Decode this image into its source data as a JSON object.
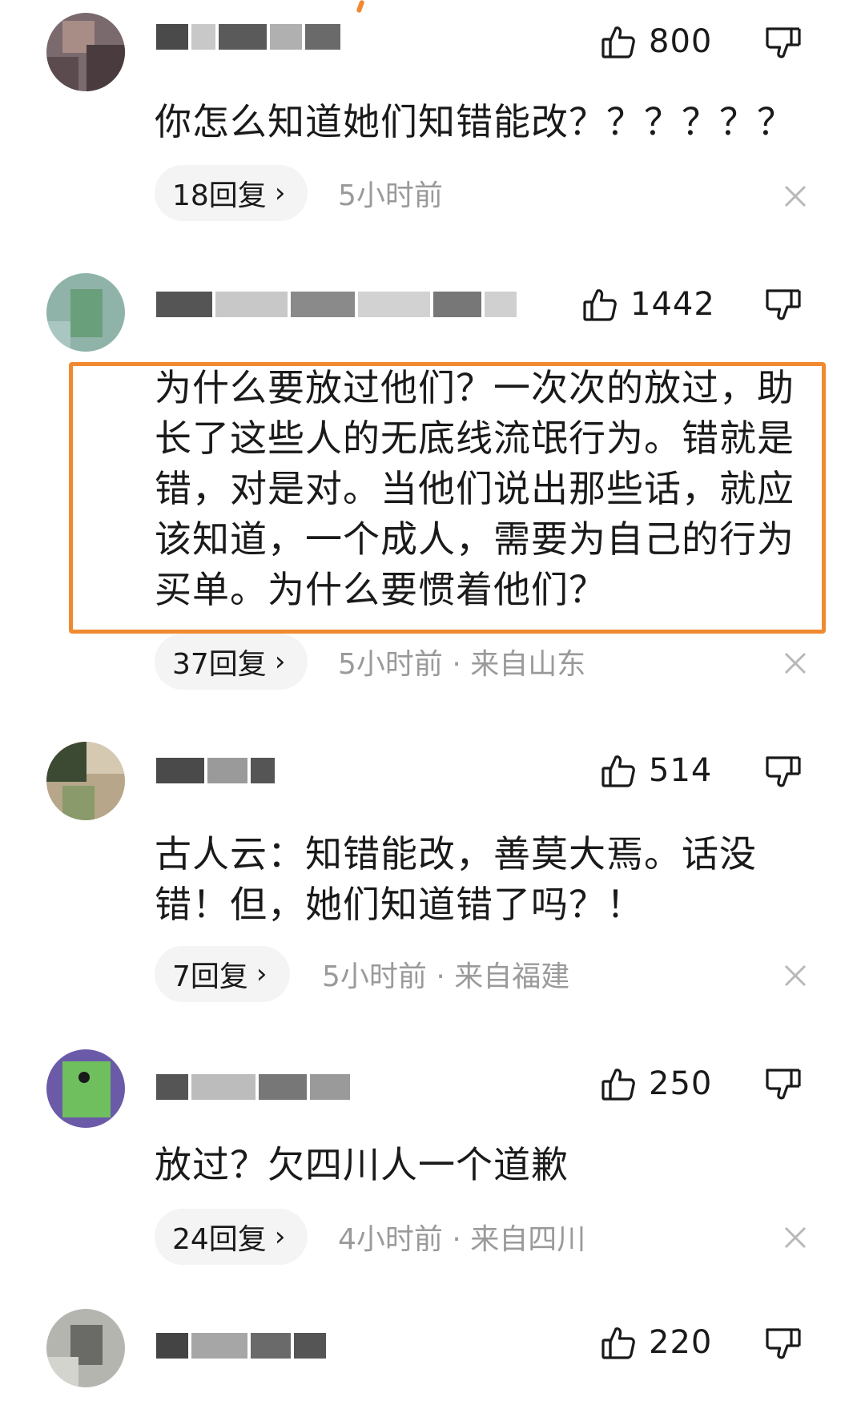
{
  "accent_color": "#f08a30",
  "comments": [
    {
      "likes": "800",
      "text": "你怎么知道她们知错能改？？？？？？",
      "replies": "18回复",
      "meta": "5小时前"
    },
    {
      "likes": "1442",
      "text": "为什么要放过他们？一次次的放过，助长了这些人的无底线流氓行为。错就是错，对是对。当他们说出那些话，就应该知道，一个成人，需要为自己的行为买单。为什么要惯着他们？",
      "replies": "37回复",
      "meta": "5小时前 · 来自山东"
    },
    {
      "likes": "514",
      "text": "古人云：知错能改，善莫大焉。话没错！但，她们知道错了吗？！",
      "replies": "7回复",
      "meta": "5小时前 · 来自福建"
    },
    {
      "likes": "250",
      "text": "放过？欠四川人一个道歉",
      "replies": "24回复",
      "meta": "4小时前 · 来自四川"
    },
    {
      "likes": "220"
    }
  ],
  "icons": {
    "like": "thumbs-up-icon",
    "dislike": "thumbs-down-icon",
    "close": "close-icon",
    "chevron": "chevron-right-icon"
  }
}
